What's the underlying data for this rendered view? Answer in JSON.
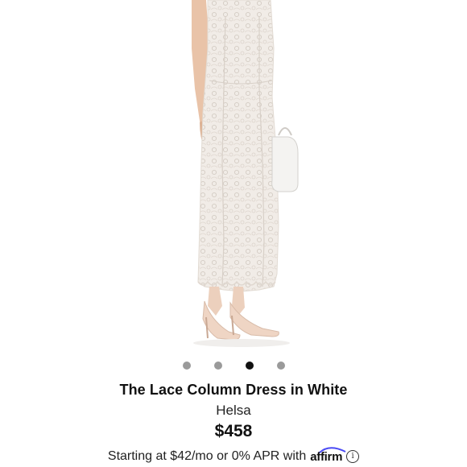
{
  "product": {
    "title": "The Lace Column Dress in White",
    "brand": "Helsa",
    "price": "$458"
  },
  "carousel": {
    "dot_count": 4,
    "active_index": 2
  },
  "financing": {
    "text": "Starting at $42/mo or 0% APR with",
    "provider_logo": "affirm",
    "info_icon": "i"
  },
  "colors": {
    "dot_inactive": "#9a9a9a",
    "dot_active": "#111111",
    "text": "#111111"
  },
  "icons": {
    "info": "info-circle-icon",
    "affirm": "affirm-logo-icon"
  }
}
